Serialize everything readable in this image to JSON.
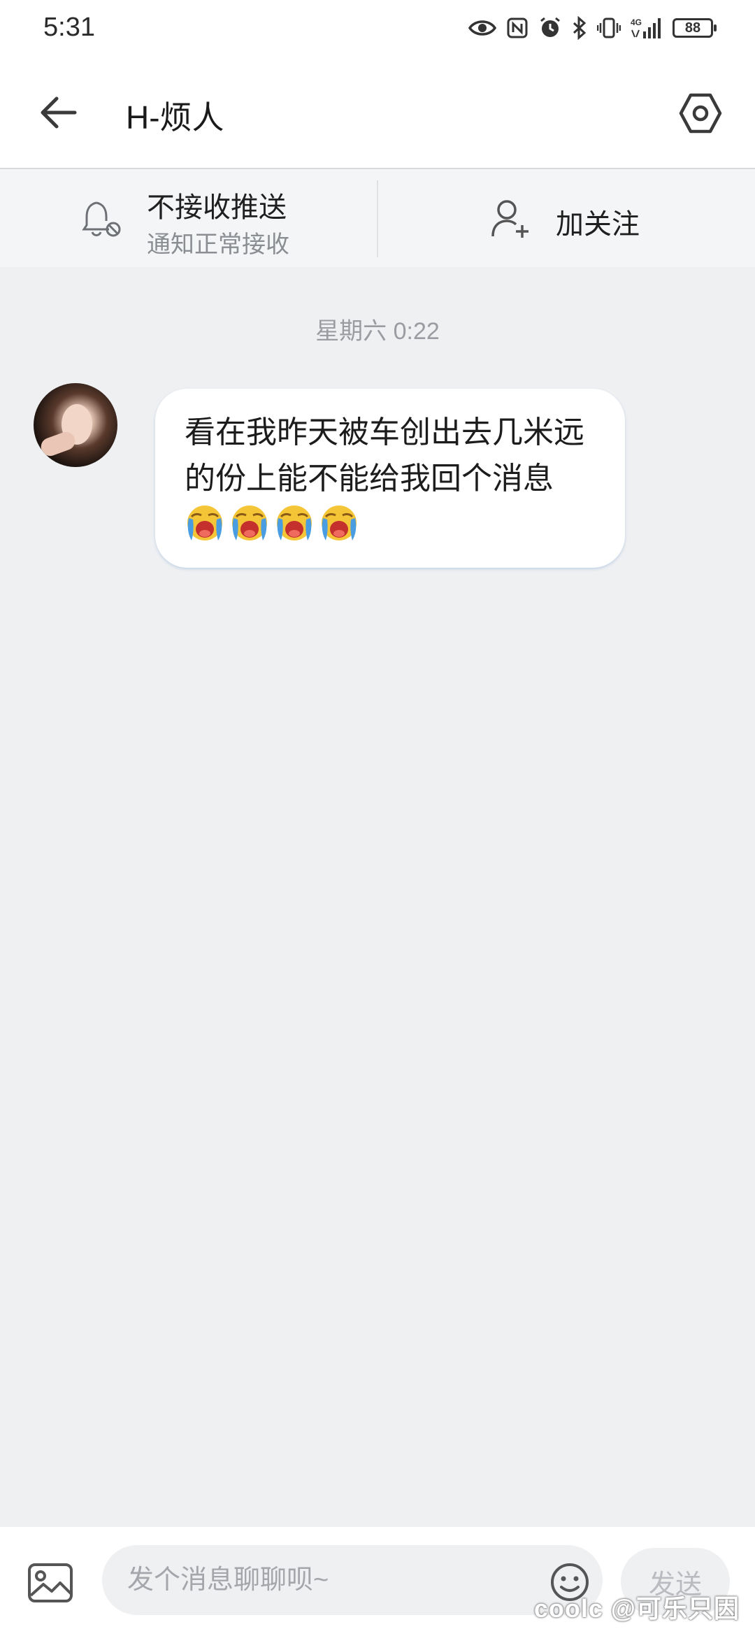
{
  "status_bar": {
    "time": "5:31",
    "battery": "88",
    "network": "4G",
    "icons": [
      "eye-icon",
      "nfc-icon",
      "alarm-icon",
      "bluetooth-icon",
      "vibrate-icon",
      "signal-icon",
      "battery-icon"
    ]
  },
  "header": {
    "title": "H-烦人",
    "back_icon": "arrow-left-icon",
    "settings_icon": "hexagon-settings-icon"
  },
  "action_bar": {
    "push": {
      "label": "不接收推送",
      "sublabel": "通知正常接收",
      "icon": "bell-muted-icon"
    },
    "follow": {
      "label": "加关注",
      "icon": "add-user-icon"
    }
  },
  "chat": {
    "timestamp": "星期六 0:22",
    "messages": [
      {
        "sender": "other",
        "text": "看在我昨天被车创出去几米远的份上能不能给我回个消息",
        "emoji": [
          "loudly-crying-face",
          "loudly-crying-face",
          "loudly-crying-face",
          "loudly-crying-face"
        ]
      }
    ]
  },
  "composer": {
    "placeholder": "发个消息聊聊呗~",
    "value": "",
    "send_label": "发送",
    "image_icon": "image-icon",
    "emoji_icon": "smile-icon"
  },
  "watermark": "coolc @可乐只因"
}
